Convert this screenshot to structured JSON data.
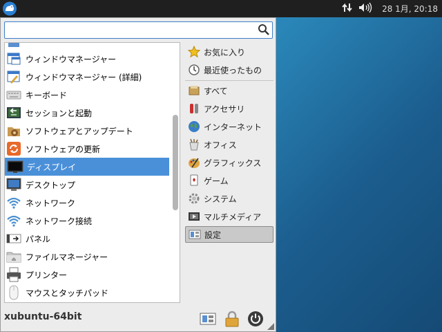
{
  "panel": {
    "clock": "28 1月, 20:18",
    "icons": [
      "xfce-menu-icon",
      "network-icon",
      "volume-icon"
    ]
  },
  "search": {
    "value": "",
    "placeholder": ""
  },
  "apps": [
    {
      "label": "",
      "icon": "partial-icon"
    },
    {
      "label": "ウィンドウマネージャー",
      "icon": "window-manager-icon"
    },
    {
      "label": "ウィンドウマネージャー (詳細)",
      "icon": "window-manager-tweaks-icon"
    },
    {
      "label": "キーボード",
      "icon": "keyboard-icon"
    },
    {
      "label": "セッションと起動",
      "icon": "session-icon"
    },
    {
      "label": "ソフトウェアとアップデート",
      "icon": "software-sources-icon"
    },
    {
      "label": "ソフトウェアの更新",
      "icon": "software-update-icon"
    },
    {
      "label": "ディスプレイ",
      "icon": "display-icon"
    },
    {
      "label": "デスクトップ",
      "icon": "desktop-icon"
    },
    {
      "label": "ネットワーク",
      "icon": "wifi-icon"
    },
    {
      "label": "ネットワーク接続",
      "icon": "wifi-icon"
    },
    {
      "label": "パネル",
      "icon": "panel-icon"
    },
    {
      "label": "ファイルマネージャー",
      "icon": "file-manager-icon"
    },
    {
      "label": "プリンター",
      "icon": "printer-icon"
    },
    {
      "label": "マウスとタッチパッド",
      "icon": "mouse-icon"
    }
  ],
  "selected_app": "ディスプレイ",
  "categories": [
    {
      "label": "お気に入り",
      "icon": "star-icon"
    },
    {
      "label": "最近使ったもの",
      "icon": "recent-icon"
    },
    {
      "label": "すべて",
      "icon": "all-apps-icon"
    },
    {
      "label": "アクセサリ",
      "icon": "accessories-icon"
    },
    {
      "label": "インターネット",
      "icon": "internet-icon"
    },
    {
      "label": "オフィス",
      "icon": "office-icon"
    },
    {
      "label": "グラフィックス",
      "icon": "graphics-icon"
    },
    {
      "label": "ゲーム",
      "icon": "games-icon"
    },
    {
      "label": "システム",
      "icon": "system-icon"
    },
    {
      "label": "マルチメディア",
      "icon": "multimedia-icon"
    },
    {
      "label": "設定",
      "icon": "settings-icon"
    }
  ],
  "selected_category": "設定",
  "footer": {
    "hostname": "xubuntu-64bit",
    "buttons": [
      "settings-manager-icon",
      "lock-icon",
      "power-icon"
    ]
  },
  "colors": {
    "accent": "#4a90d9",
    "panel_bg": "#1f1f1f",
    "menu_bg": "#ececec"
  }
}
